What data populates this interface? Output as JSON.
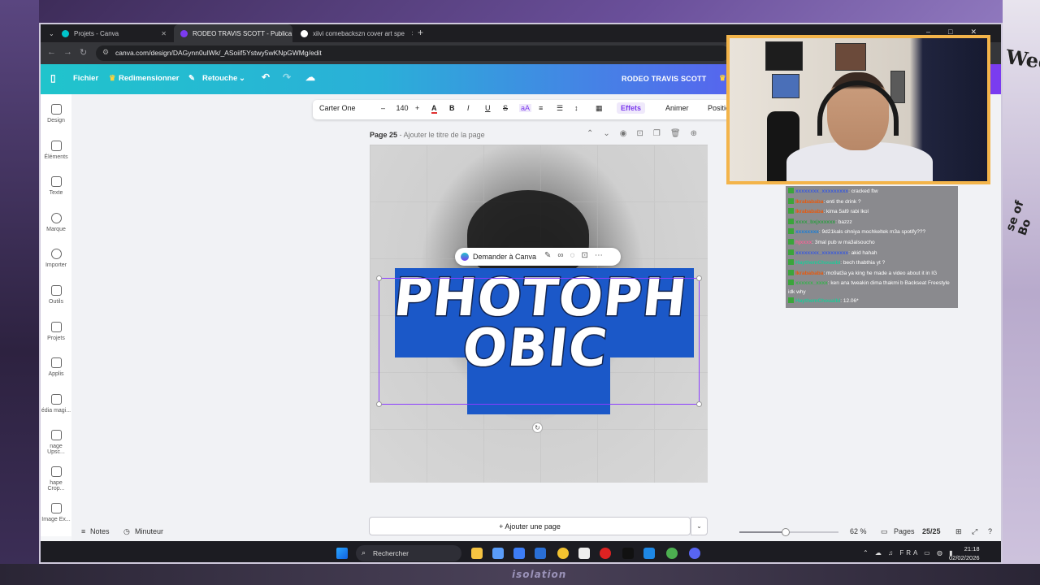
{
  "browser": {
    "tabs": [
      {
        "title": "Projets - Canva",
        "color": "#00c4cc"
      },
      {
        "title": "RODEO TRAVIS SCOTT - Publica",
        "color": "#7b3bf0"
      },
      {
        "title": "xiivi comebackszn cover art spe",
        "color": "#ffffff"
      }
    ],
    "url": "canva.com/design/DAGynn0uIWk/_ASoiif5Ystwy5wKNpGWMg/edit"
  },
  "toolbar": {
    "file": "Fichier",
    "resize": "Redimensionner",
    "retouch": "Retouche",
    "doc_title": "RODEO TRAVIS SCOTT"
  },
  "sidebar": {
    "items": [
      {
        "label": "Design",
        "icon": "design-icon"
      },
      {
        "label": "Éléments",
        "icon": "elements-icon"
      },
      {
        "label": "Texte",
        "icon": "text-icon"
      },
      {
        "label": "Marque",
        "icon": "brand-icon"
      },
      {
        "label": "Importer",
        "icon": "upload-icon"
      },
      {
        "label": "Outils",
        "icon": "tools-icon"
      },
      {
        "label": "Projets",
        "icon": "folder-icon"
      },
      {
        "label": "Applis",
        "icon": "apps-icon"
      },
      {
        "label": "édia magi...",
        "icon": "magic-media-icon"
      },
      {
        "label": "nage Upsc...",
        "icon": "image-upscale-icon"
      },
      {
        "label": "hape Crop...",
        "icon": "shape-crop-icon"
      },
      {
        "label": "Image Ex...",
        "icon": "image-expand-icon"
      }
    ]
  },
  "format_bar": {
    "font": "Carter One",
    "size": "140",
    "effects": "Effets",
    "animate": "Animer",
    "position": "Position"
  },
  "page": {
    "number": "Page 25",
    "title_placeholder": "Ajouter le titre de la page"
  },
  "design": {
    "line1": "PHOTOPH",
    "line2": "OBIC",
    "ask_canva": "Demander à Canva"
  },
  "add_page": "+ Ajouter une page",
  "status": {
    "notes": "Notes",
    "timer": "Minuteur",
    "zoom": "62 %",
    "zoom_level": 0.47,
    "pages_label": "Pages",
    "pages_count": "25/25"
  },
  "taskbar": {
    "search": "Rechercher",
    "lang": "FRA",
    "time": "21:18",
    "date": "02/02/2026"
  },
  "chat": [
    {
      "user": "xxxxxxxx_xxxxxxxxx",
      "color": "#3b5bdb",
      "msg": ": cracked ftw"
    },
    {
      "user": "Ikrabababa",
      "color": "#e8590c",
      "msg": ": enti the drink ?"
    },
    {
      "user": "Ikrabababa",
      "color": "#e8590c",
      "msg": ": kima 5al9 rabi lkol"
    },
    {
      "user": "xxxx_bxjxxxxxx",
      "color": "#2f9e44",
      "msg": ": bazzz"
    },
    {
      "user": "xxxxxxxx",
      "color": "#1c7ed6",
      "msg": ": 9d21kals ohniya mochkeltek m3a spotify???"
    },
    {
      "user": "hjxxxx",
      "color": "#f06595",
      "msg": ": 3mal pub w ma3alsoucho"
    },
    {
      "user": "xxxxxxxx_xxxxxxxxx",
      "color": "#3b5bdb",
      "msg": ": akid hahah"
    },
    {
      "user": "HaythemChouaibi",
      "color": "#20c997",
      "msg": ": bech thabthia yt ?"
    },
    {
      "user": "Ikrabababa",
      "color": "#e8590c",
      "msg": ": mo9at3a ya king he made a video about it in IG"
    },
    {
      "user": "xxxxxx_xxxx",
      "color": "#37b24d",
      "msg": ": ken ana tweakin dima thakmi b Backseat Freestyle idk why"
    },
    {
      "user": "HaythemChouaibi",
      "color": "#20c997",
      "msg": ": 12.06*"
    }
  ],
  "decor": {
    "right_text_1": "Week",
    "right_text_2": "se of Bo",
    "watermark": "isolation"
  }
}
